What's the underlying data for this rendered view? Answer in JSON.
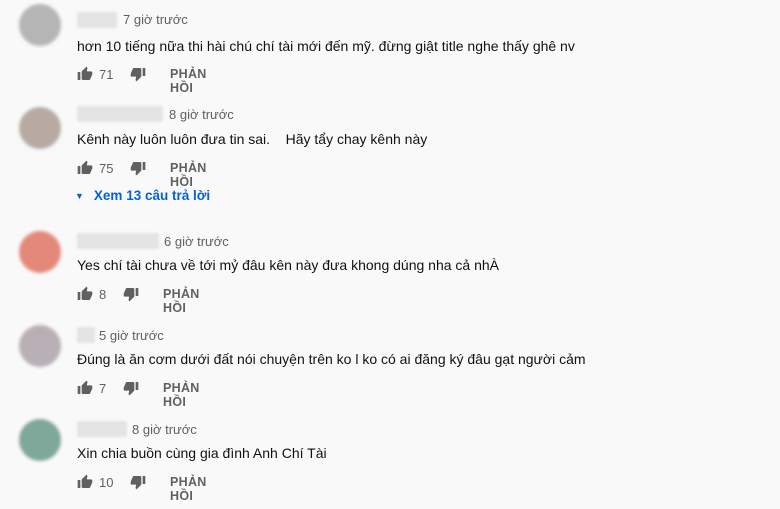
{
  "colors": {
    "link": "#065fd4",
    "meta": "#606060",
    "avatars": [
      "#b5b5b5",
      "#b7aaa3",
      "#e4897a",
      "#b8b0b4",
      "#7fa79a"
    ]
  },
  "icons": {
    "like": "thumbs-up-icon",
    "dislike": "thumbs-down-icon"
  },
  "comments": [
    {
      "time": "7 giờ trước",
      "text": "hơn 10 tiếng nữa thi hài chú chí tài mới đến mỹ. đừng giật title nghe thấy ghê nv",
      "likes": "71",
      "reply_label": "PHẢN HỒI"
    },
    {
      "time": "8 giờ trước",
      "text": "Kênh này luôn luôn đưa tin sai.    Hãy tẩy chay kênh này",
      "likes": "75",
      "reply_label": "PHẢN HỒI"
    },
    {
      "time": "6 giờ trước",
      "text": "Yes chí tài chưa về tới mỷ đâu kên này đưa khong dúng nha cả nhÀ",
      "likes": "8",
      "reply_label": "PHẢN HỒI"
    },
    {
      "time": "5 giờ trước",
      "text": "Đúng là ăn cơm dưới đất nói chuyện trên ko l ko có ai đăng ký đâu gạt người cảm",
      "likes": "7",
      "reply_label": "PHẢN HỒI"
    },
    {
      "time": "8 giờ trước",
      "text": "Xin chia buồn cùng gia đình Anh Chí Tài",
      "likes": "10",
      "reply_label": "PHẢN HỒI"
    }
  ],
  "replies_toggle": {
    "label": "Xem 13 câu trả lời"
  }
}
